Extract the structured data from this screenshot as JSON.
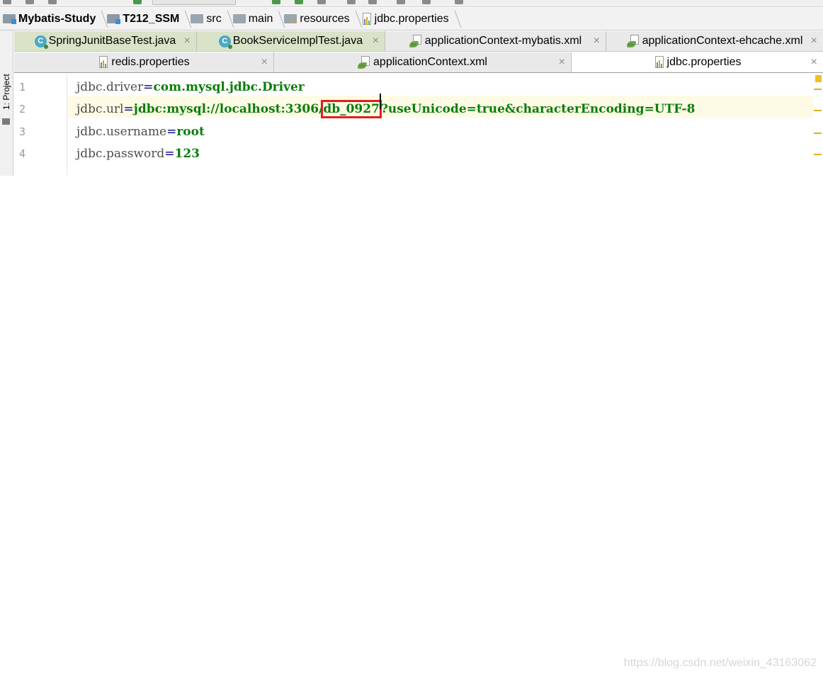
{
  "breadcrumb": [
    {
      "label": "Mybatis-Study",
      "icon": "module-folder-icon",
      "bold": true
    },
    {
      "label": "T212_SSM",
      "icon": "module-folder-icon",
      "bold": true
    },
    {
      "label": "src",
      "icon": "folder-icon",
      "bold": false
    },
    {
      "label": "main",
      "icon": "folder-icon",
      "bold": false
    },
    {
      "label": "resources",
      "icon": "resources-folder-icon",
      "bold": false
    },
    {
      "label": "jdbc.properties",
      "icon": "properties-file-icon",
      "bold": false
    }
  ],
  "side_panel": {
    "label": "1: Project"
  },
  "tabs_row1": [
    {
      "label": "SpringJunitBaseTest.java",
      "icon": "java-class-icon",
      "style": "test"
    },
    {
      "label": "BookServiceImplTest.java",
      "icon": "java-class-icon",
      "style": "test"
    },
    {
      "label": "applicationContext-mybatis.xml",
      "icon": "spring-xml-icon",
      "style": "normal"
    },
    {
      "label": "applicationContext-ehcache.xml",
      "icon": "spring-xml-icon",
      "style": "normal"
    }
  ],
  "tabs_row2": [
    {
      "label": "redis.properties",
      "icon": "properties-file-icon",
      "style": "normal"
    },
    {
      "label": "applicationContext.xml",
      "icon": "spring-xml-icon",
      "style": "normal"
    },
    {
      "label": "jdbc.properties",
      "icon": "properties-file-icon",
      "style": "active"
    }
  ],
  "close_glyph": "×",
  "editor": {
    "lines": [
      {
        "num": "1",
        "key": "jdbc.driver",
        "eq": "=",
        "value": "com.mysql.jdbc.Driver"
      },
      {
        "num": "2",
        "key": "jdbc.url",
        "eq": "=",
        "value_pre": "jdbc:mysql://localhost:3306/",
        "value_highlight": "db_0927",
        "value_post": "?useUnicode=true&characterEncoding=UTF-8"
      },
      {
        "num": "3",
        "key": "jdbc.username",
        "eq": "=",
        "value": "root"
      },
      {
        "num": "4",
        "key": "jdbc.password",
        "eq": "=",
        "value": "123"
      }
    ],
    "current_line": 2,
    "highlight_color": "#e01e1e"
  },
  "watermark": "https://blog.csdn.net/weixin_43163062"
}
